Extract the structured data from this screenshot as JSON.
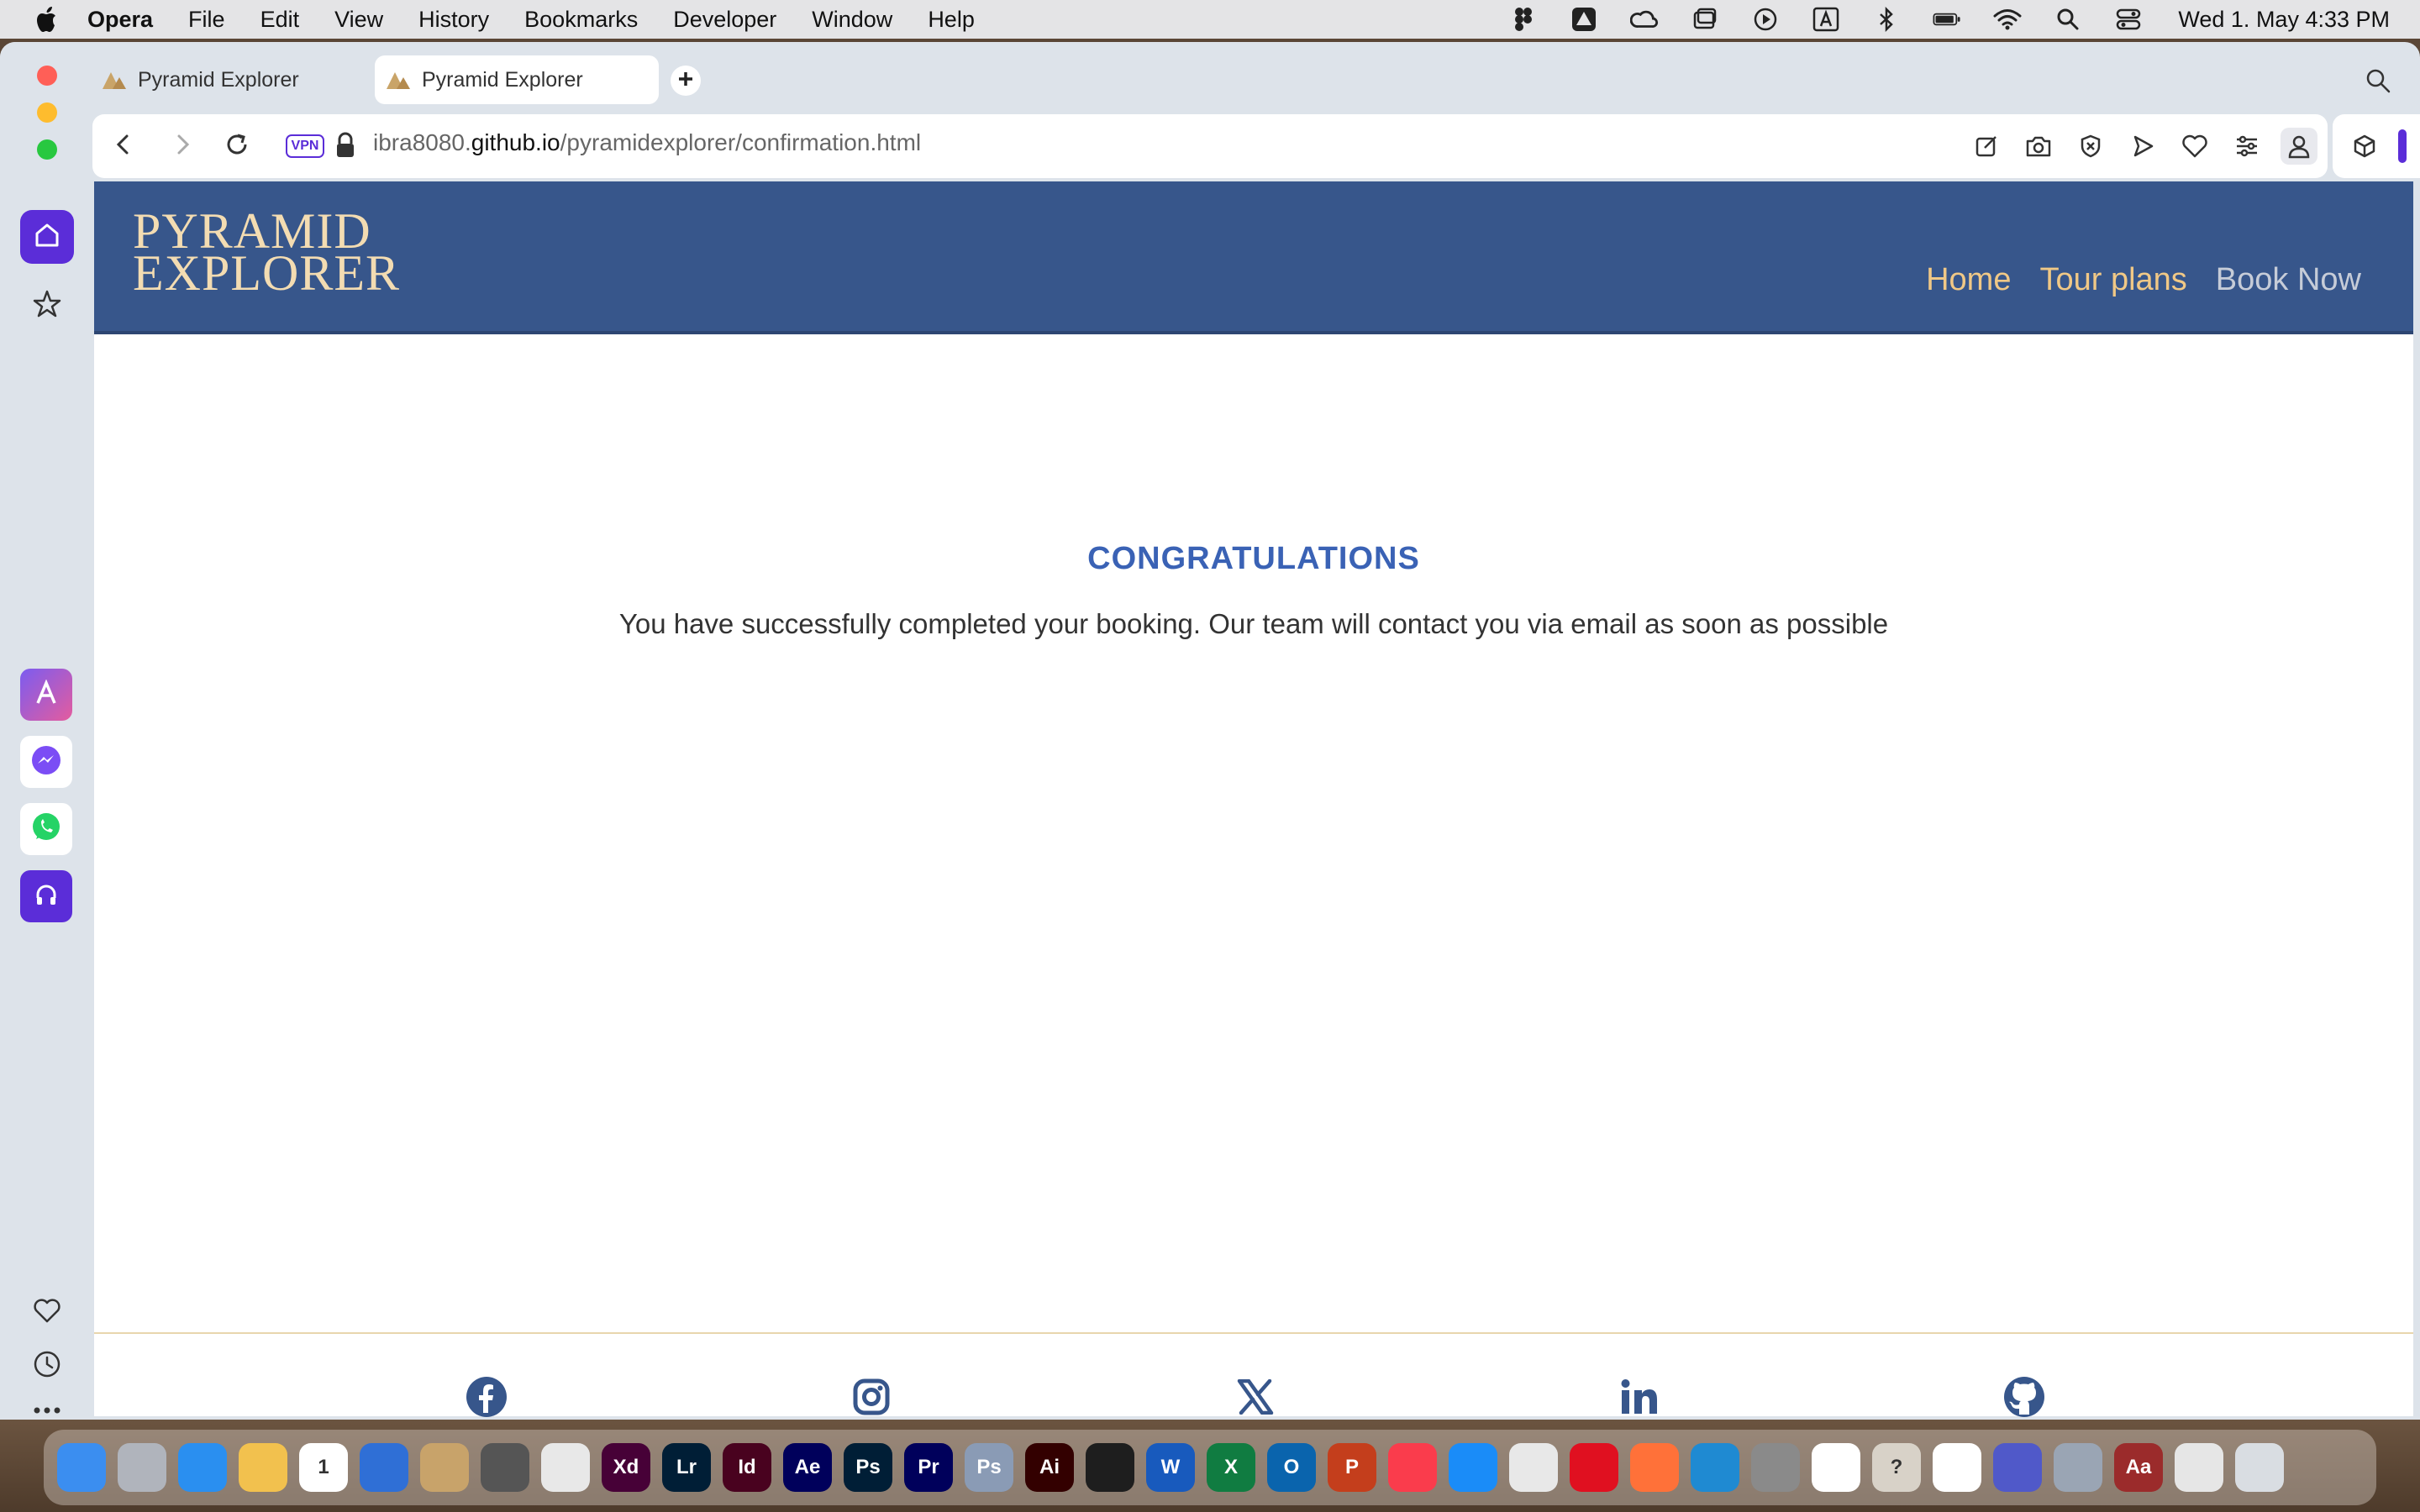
{
  "menubar": {
    "app_name": "Opera",
    "items": [
      "File",
      "Edit",
      "View",
      "History",
      "Bookmarks",
      "Developer",
      "Window",
      "Help"
    ],
    "clock": "Wed 1. May  4:33 PM"
  },
  "browser": {
    "tabs": [
      {
        "title": "Pyramid Explorer",
        "active": false
      },
      {
        "title": "Pyramid Explorer",
        "active": true
      }
    ],
    "url": {
      "subdomain": "ibra8080.",
      "domain": "github.io",
      "path": "/pyramidexplorer/confirmation.html"
    },
    "vpn_label": "VPN",
    "accent": "#5b2dd8"
  },
  "page": {
    "logo": {
      "line1": "PYRAMID",
      "line2": "EXPLORER"
    },
    "nav": [
      {
        "label": "Home"
      },
      {
        "label": "Tour plans"
      },
      {
        "label": "Book Now"
      }
    ],
    "confirmation": {
      "title": "CONGRATULATIONS",
      "message": "You have successfully completed your booking. Our team will contact you via email as soon as possible"
    },
    "social": [
      "facebook",
      "instagram",
      "x",
      "linkedin",
      "github"
    ],
    "colors": {
      "header_bg": "#37568b",
      "nav_link": "#f0c886",
      "title": "#3a62b5",
      "logo": "#f3dcb2"
    }
  },
  "dock": {
    "apps": [
      {
        "name": "finder",
        "label": "",
        "color": "#3b8ef0"
      },
      {
        "name": "launchpad",
        "label": "",
        "color": "#b0b4bc"
      },
      {
        "name": "safari",
        "label": "",
        "color": "#2a8ff0"
      },
      {
        "name": "photos",
        "label": "",
        "color": "#f2c14e"
      },
      {
        "name": "calendar",
        "label": "1",
        "color": "#ffffff"
      },
      {
        "name": "thunderbird",
        "label": "",
        "color": "#2f6fd6"
      },
      {
        "name": "contacts",
        "label": "",
        "color": "#c8a36a"
      },
      {
        "name": "calculator",
        "label": "",
        "color": "#555555"
      },
      {
        "name": "textedit",
        "label": "",
        "color": "#e8e8e8"
      },
      {
        "name": "xd",
        "label": "Xd",
        "color": "#470137"
      },
      {
        "name": "lightroom",
        "label": "Lr",
        "color": "#001e36"
      },
      {
        "name": "indesign",
        "label": "Id",
        "color": "#49021f"
      },
      {
        "name": "after-effects",
        "label": "Ae",
        "color": "#00005b"
      },
      {
        "name": "photoshop",
        "label": "Ps",
        "color": "#001e36"
      },
      {
        "name": "premiere",
        "label": "Pr",
        "color": "#00005b"
      },
      {
        "name": "photoshop-2",
        "label": "Ps",
        "color": "#8a9bb5"
      },
      {
        "name": "illustrator",
        "label": "Ai",
        "color": "#330000"
      },
      {
        "name": "figma",
        "label": "",
        "color": "#1e1e1e"
      },
      {
        "name": "word",
        "label": "W",
        "color": "#185abd"
      },
      {
        "name": "excel",
        "label": "X",
        "color": "#107c41"
      },
      {
        "name": "outlook",
        "label": "O",
        "color": "#0a64ad"
      },
      {
        "name": "powerpoint",
        "label": "P",
        "color": "#c43e1c"
      },
      {
        "name": "music",
        "label": "",
        "color": "#fa3c4c"
      },
      {
        "name": "app-store",
        "label": "",
        "color": "#1a8cf8"
      },
      {
        "name": "chrome",
        "label": "",
        "color": "#e8e8e8"
      },
      {
        "name": "opera",
        "label": "",
        "color": "#e01020"
      },
      {
        "name": "firefox",
        "label": "",
        "color": "#ff7139"
      },
      {
        "name": "vscode",
        "label": "",
        "color": "#1f8ad2"
      },
      {
        "name": "system-settings",
        "label": "",
        "color": "#8a8a8a"
      },
      {
        "name": "capcut",
        "label": "",
        "color": "#ffffff"
      },
      {
        "name": "help",
        "label": "?",
        "color": "#d8d2c8"
      },
      {
        "name": "freeform",
        "label": "",
        "color": "#ffffff"
      },
      {
        "name": "teams",
        "label": "",
        "color": "#5059c9"
      },
      {
        "name": "preview",
        "label": "",
        "color": "#9aa5b4"
      },
      {
        "name": "dictionary",
        "label": "Aa",
        "color": "#9b2b2b"
      },
      {
        "name": "documents",
        "label": "",
        "color": "#e6e6e6"
      },
      {
        "name": "trash",
        "label": "",
        "color": "#d9dde2"
      }
    ]
  }
}
